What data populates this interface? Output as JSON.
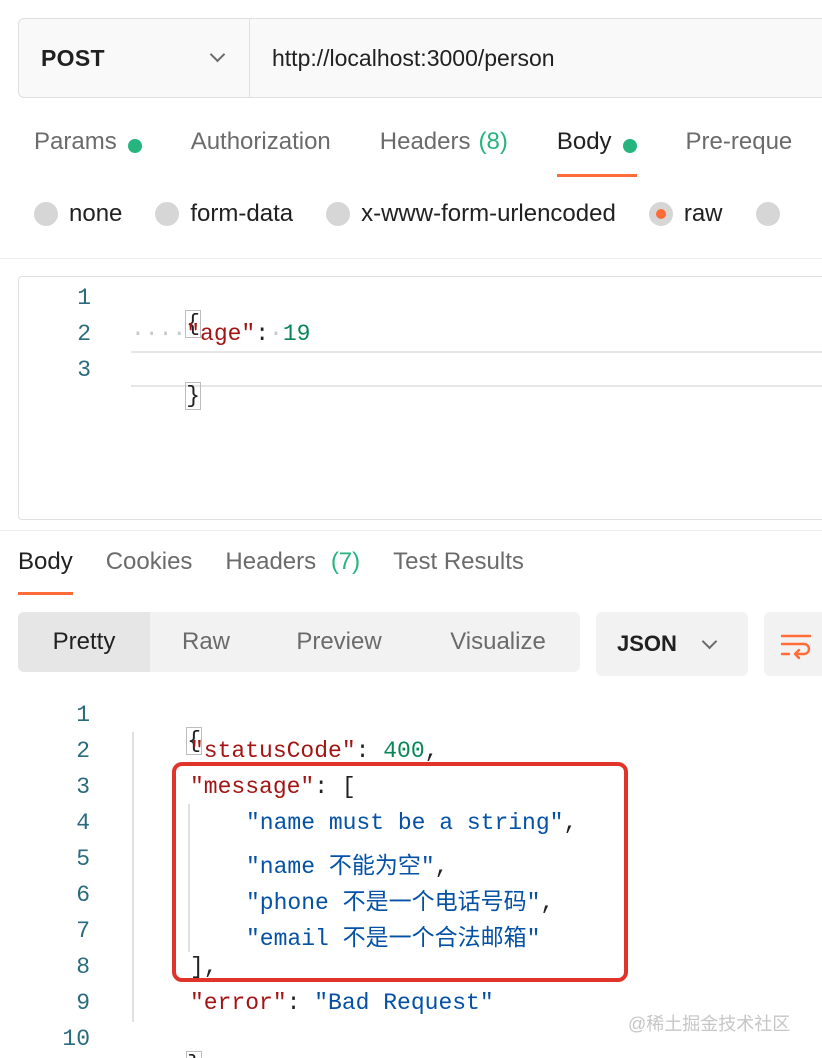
{
  "request": {
    "method": "POST",
    "url": "http://localhost:3000/person",
    "tabs": [
      {
        "label": "Params",
        "indicator": "green-dot"
      },
      {
        "label": "Authorization"
      },
      {
        "label": "Headers",
        "count": "(8)"
      },
      {
        "label": "Body",
        "indicator": "green-dot",
        "active": true
      },
      {
        "label": "Pre-reque"
      }
    ],
    "body_types": [
      {
        "label": "none"
      },
      {
        "label": "form-data"
      },
      {
        "label": "x-www-form-urlencoded"
      },
      {
        "label": "raw",
        "selected": true
      }
    ],
    "editor": {
      "line_numbers": [
        "1",
        "2",
        "3"
      ],
      "open_brace": "{",
      "key": "\"age\"",
      "colon": ":",
      "value": "19",
      "close_brace": "}"
    }
  },
  "response": {
    "tabs": [
      {
        "label": "Body",
        "active": true
      },
      {
        "label": "Cookies"
      },
      {
        "label": "Headers",
        "count": "(7)"
      },
      {
        "label": "Test Results"
      }
    ],
    "views": [
      {
        "label": "Pretty",
        "active": true
      },
      {
        "label": "Raw"
      },
      {
        "label": "Preview"
      },
      {
        "label": "Visualize"
      }
    ],
    "format": "JSON",
    "line_numbers": [
      "1",
      "2",
      "3",
      "4",
      "5",
      "6",
      "7",
      "8",
      "9",
      "10"
    ],
    "json": {
      "open_brace": "{",
      "status_key": "\"statusCode\"",
      "status_value": "400",
      "message_key": "\"message\"",
      "open_bracket": "[",
      "messages": [
        "\"name must be a string\"",
        "\"name 不能为空\"",
        "\"phone 不是一个电话号码\"",
        "\"email 不是一个合法邮箱\""
      ],
      "close_bracket": "],",
      "error_key": "\"error\"",
      "error_value": "\"Bad Request\"",
      "close_brace": "}"
    }
  },
  "watermark": "@稀土掘金技术社区",
  "colors": {
    "accent": "#ff6c37",
    "success": "#26b47f",
    "annotation": "#e0342b",
    "json_key": "#a31515",
    "json_string": "#0451a5",
    "json_number": "#098658"
  }
}
